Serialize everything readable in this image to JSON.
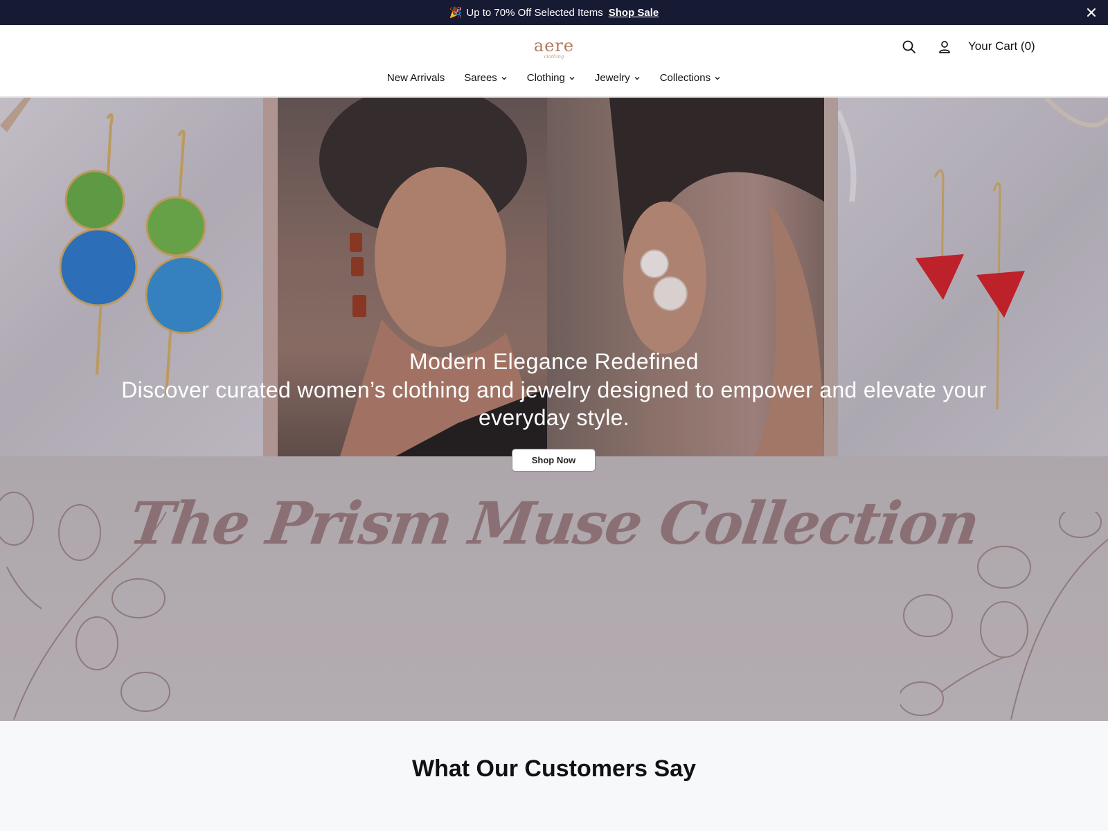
{
  "announcement": {
    "emoji": "🎉",
    "text": "Up to 70% Off Selected Items",
    "link_label": "Shop Sale"
  },
  "header": {
    "logo_text": "aere",
    "logo_sub": "clothing",
    "cart_label": "Your Cart (0)",
    "nav": [
      {
        "label": "New Arrivals",
        "has_dropdown": false
      },
      {
        "label": "Sarees",
        "has_dropdown": true
      },
      {
        "label": "Clothing",
        "has_dropdown": true
      },
      {
        "label": "Jewelry",
        "has_dropdown": true
      },
      {
        "label": "Collections",
        "has_dropdown": true
      }
    ]
  },
  "hero": {
    "title": "Modern Elegance Redefined",
    "subtitle": "Discover curated women’s clothing and jewelry designed to empower and elevate your everyday style.",
    "cta_label": "Shop Now",
    "collection_title": "The Prism Muse Collection"
  },
  "testimonials": {
    "heading": "What Our Customers Say"
  },
  "colors": {
    "announce_bg": "#171a33",
    "logo": "#b07a5c",
    "collection_text": "#8a7074"
  }
}
